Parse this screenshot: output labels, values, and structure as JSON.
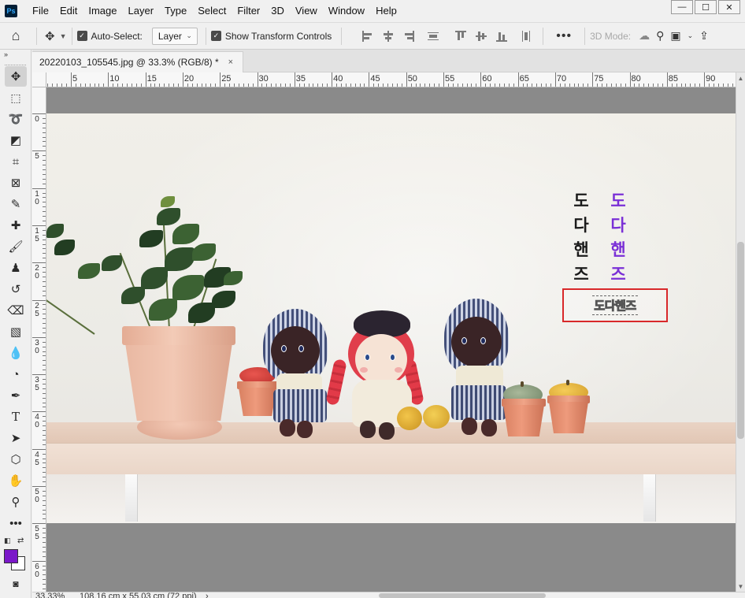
{
  "app": {
    "logo_text": "Ps"
  },
  "menu": [
    "File",
    "Edit",
    "Image",
    "Layer",
    "Type",
    "Select",
    "Filter",
    "3D",
    "View",
    "Window",
    "Help"
  ],
  "window_controls": {
    "minimize": "—",
    "restore": "☐",
    "close": "✕"
  },
  "options_bar": {
    "auto_select_label": "Auto-Select:",
    "auto_select_target": "Layer",
    "show_transform_label": "Show Transform Controls",
    "more_label": "•••",
    "mode_3d_label": "3D Mode:"
  },
  "tools_header": "»",
  "document": {
    "tab_title": "20220103_105545.jpg @ 33.3% (RGB/8) *",
    "tab_close": "×"
  },
  "ruler": {
    "h_labels": [
      "5",
      "10",
      "15",
      "20",
      "25",
      "30",
      "35",
      "40",
      "45",
      "50",
      "55",
      "60",
      "65",
      "70",
      "75",
      "80",
      "85",
      "90"
    ],
    "v_labels": [
      "0",
      "5",
      "10",
      "15",
      "20",
      "25",
      "30",
      "35",
      "40",
      "45",
      "50",
      "55",
      "60"
    ]
  },
  "canvas_text": {
    "black_column": [
      "도",
      "다",
      "핸",
      "즈"
    ],
    "purple_column": [
      "도",
      "다",
      "핸",
      "즈"
    ],
    "selected_text": "도다핸즈"
  },
  "status": {
    "zoom": "33.33%",
    "doc_size": "108.16 cm x 55.03 cm (72 ppi)",
    "arrow": "›"
  },
  "colors": {
    "foreground": "#7b18c9",
    "background": "#ffffff",
    "text_purple": "#7a2fd6",
    "selection_border": "#d8282a"
  }
}
